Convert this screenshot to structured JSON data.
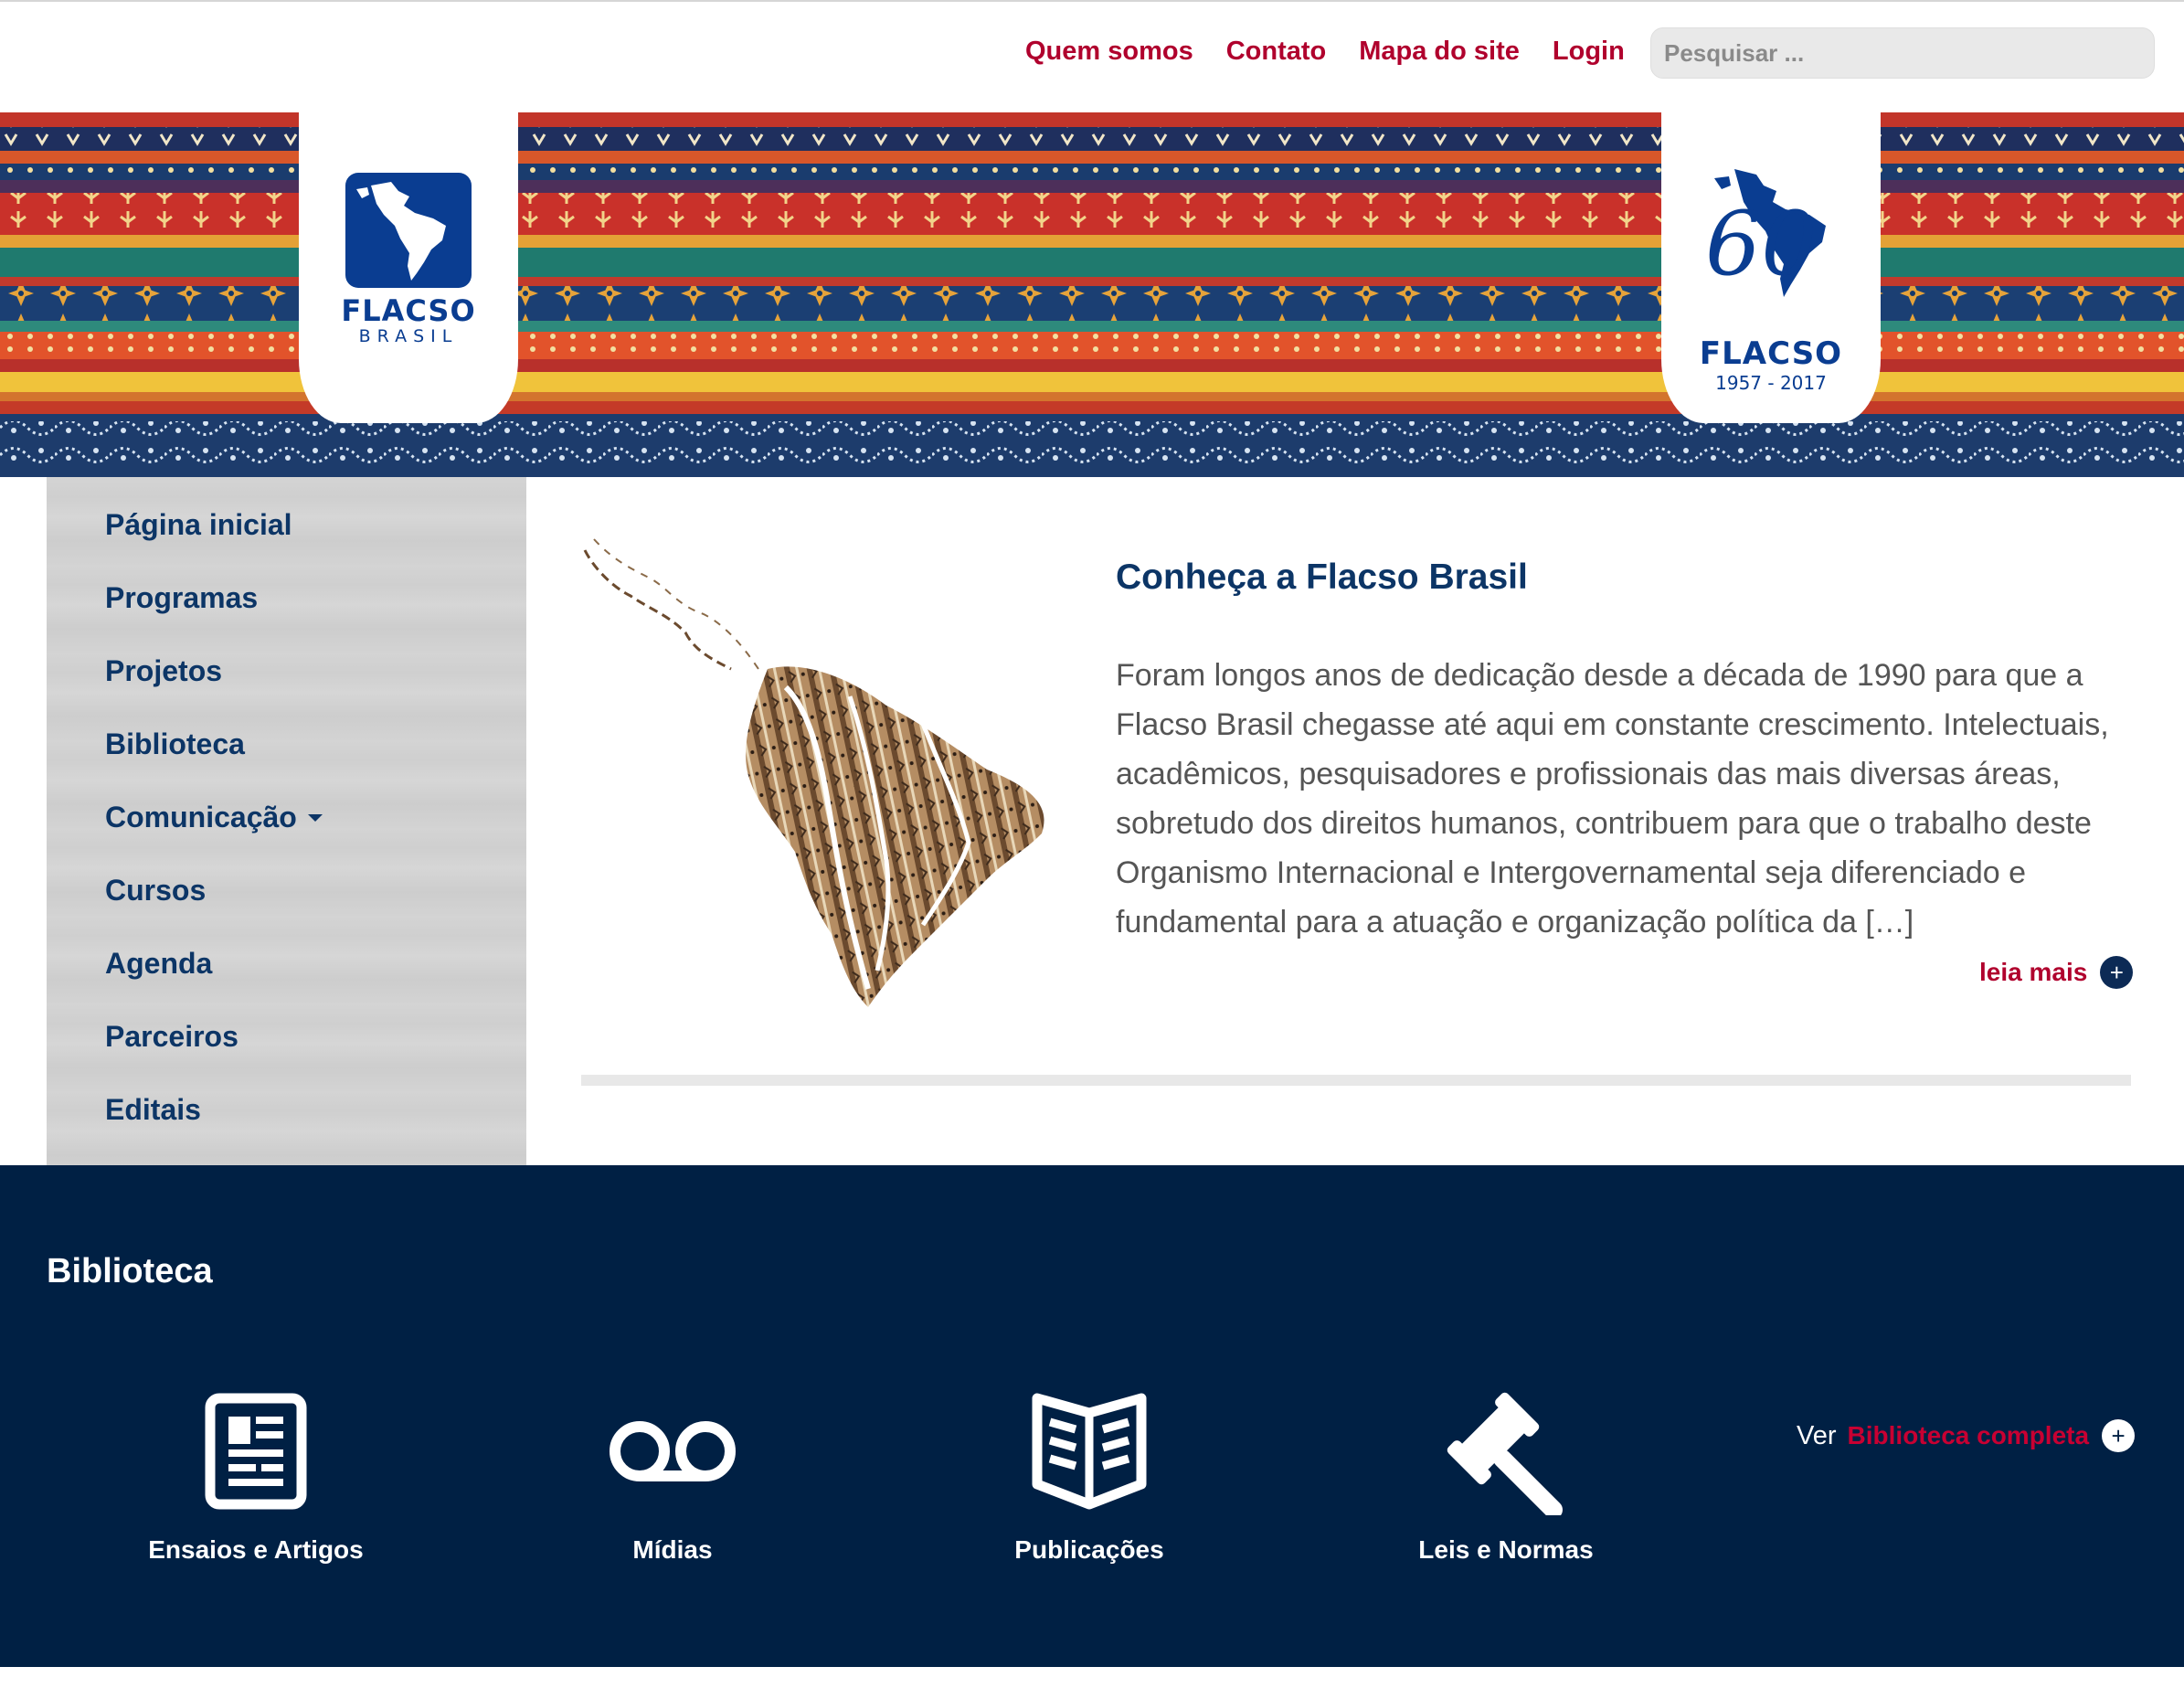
{
  "header": {
    "links": [
      "Quem somos",
      "Contato",
      "Mapa do site",
      "Login"
    ],
    "search_placeholder": "Pesquisar ..."
  },
  "logos": {
    "left": {
      "word": "FLACSO",
      "sub": "BRASIL"
    },
    "right": {
      "number": "60",
      "word": "FLACSO",
      "years": "1957 - 2017"
    }
  },
  "sidebar": {
    "items": [
      {
        "label": "Página inicial",
        "has_submenu": false
      },
      {
        "label": "Programas",
        "has_submenu": false
      },
      {
        "label": "Projetos",
        "has_submenu": false
      },
      {
        "label": "Biblioteca",
        "has_submenu": false
      },
      {
        "label": "Comunicação",
        "has_submenu": true
      },
      {
        "label": "Cursos",
        "has_submenu": false
      },
      {
        "label": "Agenda",
        "has_submenu": false
      },
      {
        "label": "Parceiros",
        "has_submenu": false
      },
      {
        "label": "Editais",
        "has_submenu": false
      }
    ]
  },
  "feature": {
    "title": "Conheça a Flacso Brasil",
    "text": "Foram longos anos de dedicação desde a década de 1990 para que a Flacso Brasil chegasse até aqui em constante crescimento. Intelectuais, acadêmicos, pesquisadores e profissionais das mais diversas áreas, sobretudo dos direitos humanos, contribuem para que o trabalho deste Organismo Internacional e Intergovernamental seja diferenciado e fundamental para a atuação e organização política da […]",
    "read_more": "leia mais",
    "plus": "+"
  },
  "library": {
    "title": "Biblioteca",
    "items": [
      {
        "label": "Ensaios e Artigos",
        "icon": "newspaper-icon"
      },
      {
        "label": "Mídias",
        "icon": "voicemail-icon"
      },
      {
        "label": "Publicações",
        "icon": "open-book-icon"
      },
      {
        "label": "Leis e Normas",
        "icon": "gavel-icon"
      }
    ],
    "more_prefix": "Ver",
    "more_link": "Biblioteca completa",
    "plus": "+"
  },
  "colors": {
    "accent_red": "#b0002d",
    "nav_blue": "#0c3566",
    "footer_navy": "#002044",
    "logo_blue": "#0a3d91"
  }
}
